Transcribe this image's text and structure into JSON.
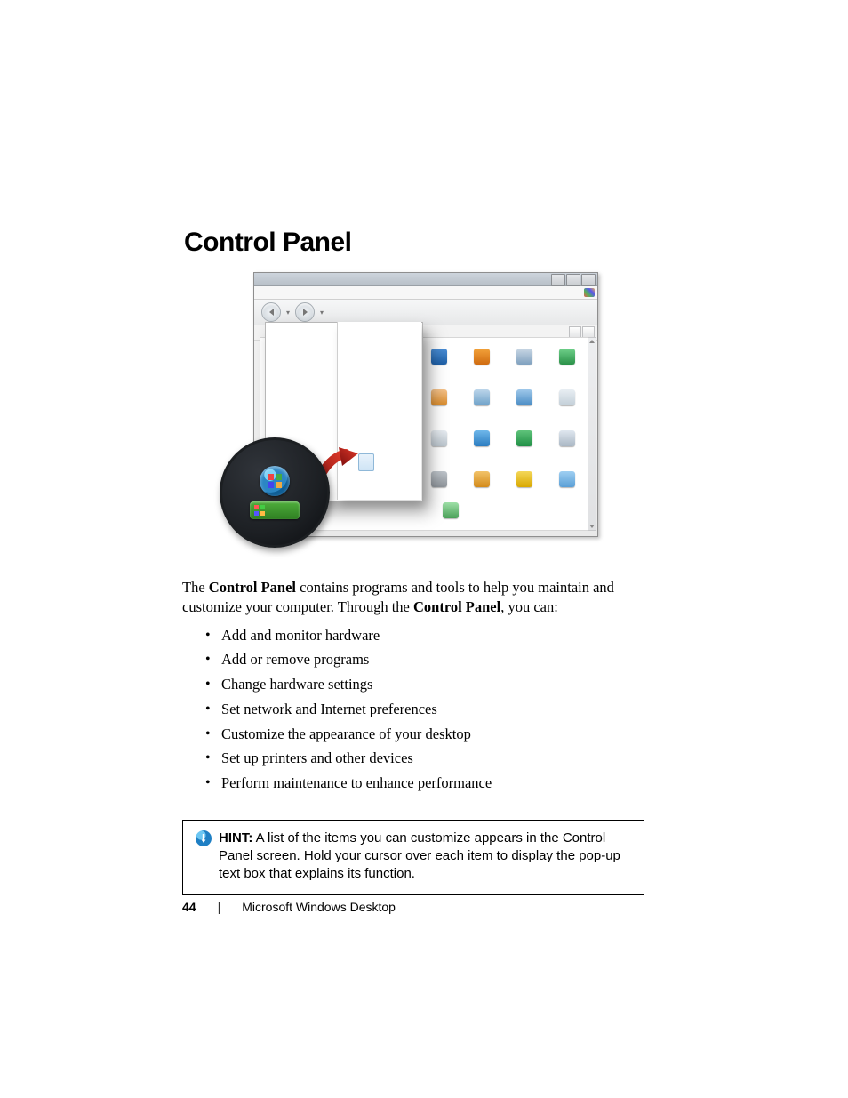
{
  "heading": "Control Panel",
  "intro_parts": {
    "p1": "The ",
    "b1": "Control Panel",
    "p2": " contains programs and tools to help you maintain and customize your computer. Through the ",
    "b2": "Control Panel",
    "p3": ", you can:"
  },
  "bullets": [
    "Add and monitor hardware",
    "Add or remove programs",
    "Change hardware settings",
    "Set network and Internet preferences",
    "Customize the appearance of your desktop",
    "Set up printers and other devices",
    "Perform maintenance to enhance performance"
  ],
  "hint_label": "HINT:",
  "hint_text": " A list of the items you can customize appears in the Control Panel screen. Hold your cursor over each item to display the pop-up text box that explains its function.",
  "footer": {
    "page": "44",
    "section": "Microsoft Windows Desktop"
  },
  "icons": [
    {
      "name": "display-icon",
      "bg": "linear-gradient(#4a8ed6,#1e5fa6)"
    },
    {
      "name": "user-accounts-icon",
      "bg": "linear-gradient(#f2a23a,#d06b10)"
    },
    {
      "name": "search-options-icon",
      "bg": "linear-gradient(#c9d7e4,#7fa0bf)"
    },
    {
      "name": "security-icon",
      "bg": "linear-gradient(#6fd08a,#2a9148)"
    },
    {
      "name": "java-icon",
      "bg": "linear-gradient(#f5c28a,#d88a2a)"
    },
    {
      "name": "audio-icon",
      "bg": "linear-gradient(#bcd5ea,#6fa2c9)"
    },
    {
      "name": "date-time-icon",
      "bg": "linear-gradient(#9fc8ea,#4a8cc4)"
    },
    {
      "name": "scheduled-tasks-icon",
      "bg": "linear-gradient(#e8eef3,#c3cfd8)"
    },
    {
      "name": "printers-icon",
      "bg": "linear-gradient(#e7ecf1,#b9c3cb)"
    },
    {
      "name": "network-connections-icon",
      "bg": "linear-gradient(#6fb7ea,#2b7cc0)"
    },
    {
      "name": "internet-options-icon",
      "bg": "linear-gradient(#5fc37a,#1f8f45)"
    },
    {
      "name": "system-icon",
      "bg": "linear-gradient(#dfe7ef,#a9b7c4)"
    },
    {
      "name": "speech-icon",
      "bg": "linear-gradient(#bfc5cb,#8e949a)"
    },
    {
      "name": "firewall-icon",
      "bg": "linear-gradient(#f2c36a,#d38a1a)"
    },
    {
      "name": "wireless-icon",
      "bg": "linear-gradient(#f4d75a,#d9a800)"
    },
    {
      "name": "fonts-icon",
      "bg": "linear-gradient(#9fcff2,#5a9fd6)"
    }
  ]
}
